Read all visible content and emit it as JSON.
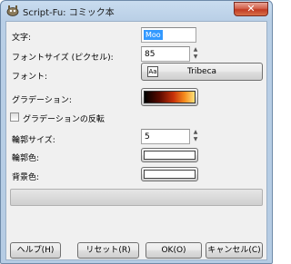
{
  "window": {
    "title": "Script-Fu: コミック本",
    "close_label": "✕"
  },
  "form": {
    "text_label": "文字:",
    "text_value": "Moo",
    "font_size_label": "フォントサイズ (ピクセル):",
    "font_size_value": "85",
    "font_label": "フォント:",
    "font_value": "Tribeca",
    "gradient_label": "グラデーション:",
    "gradient_reverse_label": "グラデーションの反転",
    "gradient_reverse_checked": false,
    "outline_size_label": "輪郭サイズ:",
    "outline_size_value": "5",
    "outline_color_label": "輪郭色:",
    "outline_color": "#ffffff",
    "bg_color_label": "背景色:",
    "bg_color": "#ffffff"
  },
  "buttons": {
    "help": "ヘルプ(H)",
    "reset": "リセット(R)",
    "ok": "OK(O)",
    "cancel": "キャンセル(C)"
  }
}
